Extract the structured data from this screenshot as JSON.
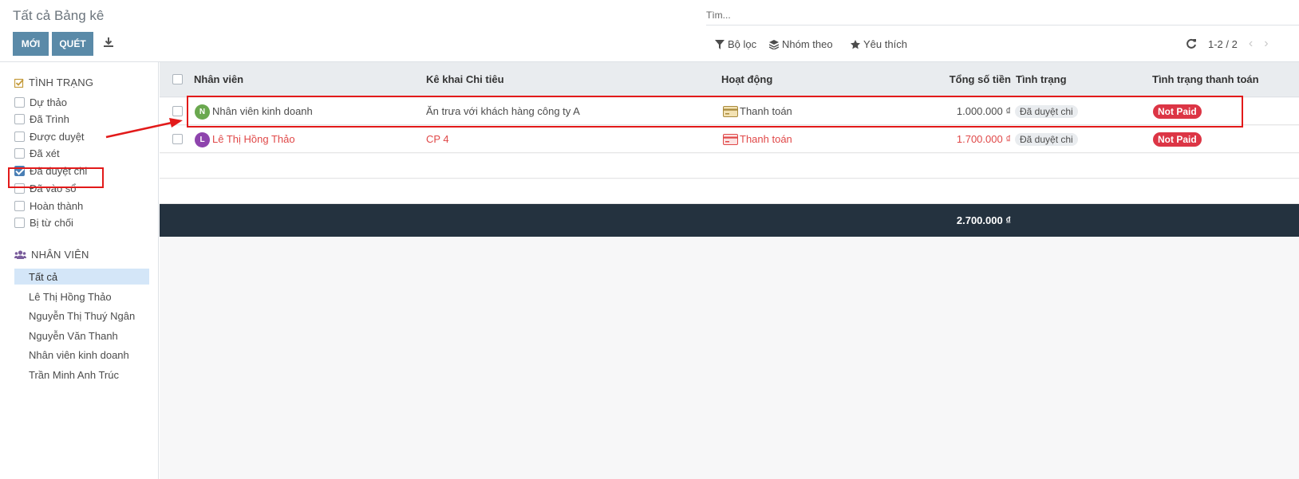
{
  "control_panel": {
    "title": "Tất cả Bảng kê",
    "new_label": "MỚI",
    "scan_label": "QUÉT",
    "search_placeholder": "Tìm...",
    "filter_label": "Bộ lọc",
    "group_label": "Nhóm theo",
    "favorite_label": "Yêu thích",
    "pager_value": "1-2 / 2"
  },
  "sidebar": {
    "status_header": "TÌNH TRẠNG",
    "status_items": [
      {
        "label": "Dự thảo",
        "checked": false
      },
      {
        "label": "Đã Trình",
        "checked": false
      },
      {
        "label": "Được duyệt",
        "checked": false
      },
      {
        "label": "Đã xét",
        "checked": false
      },
      {
        "label": "Đã duyệt chi",
        "checked": true
      },
      {
        "label": "Đã vào sổ",
        "checked": false
      },
      {
        "label": "Hoàn thành",
        "checked": false
      },
      {
        "label": "Bị từ chối",
        "checked": false
      }
    ],
    "employee_header": "NHÂN VIÊN",
    "employees": [
      {
        "label": "Tất cả",
        "active": true
      },
      {
        "label": "Lê Thị Hồng Thảo",
        "active": false
      },
      {
        "label": "Nguyễn Thị Thuý Ngân",
        "active": false
      },
      {
        "label": "Nguyễn Văn Thanh",
        "active": false
      },
      {
        "label": "Nhân viên kinh doanh",
        "active": false
      },
      {
        "label": "Trần Minh Anh Trúc",
        "active": false
      }
    ]
  },
  "table": {
    "headers": {
      "employee": "Nhân viên",
      "expense": "Kê khai Chi tiêu",
      "activity": "Hoạt động",
      "total": "Tổng số tiền",
      "status": "Tình trạng",
      "payment_status": "Tình trạng thanh toán"
    },
    "rows": [
      {
        "avatar": "N",
        "avatar_color": "#6aa84f",
        "employee": "Nhân viên kinh doanh",
        "expense": "Ăn trưa với khách hàng công ty A",
        "activity": "Thanh toán",
        "total": "1.000.000 ₫",
        "status": "Đã duyệt chi",
        "payment_status": "Not Paid"
      },
      {
        "avatar": "L",
        "avatar_color": "#8e44ad",
        "employee": "Lê Thị Hồng Thảo",
        "expense": "CP 4",
        "activity": "Thanh toán",
        "total": "1.700.000 ₫",
        "status": "Đã duyệt chi",
        "payment_status": "Not Paid"
      }
    ],
    "footer_total": "2.700.000 ₫"
  },
  "colors": {
    "primary_button": "#5a8aa8",
    "footer_bg": "#24323f",
    "not_paid_badge": "#dc3545",
    "overdue_text": "#e04848",
    "annotation": "#e21a1a"
  }
}
